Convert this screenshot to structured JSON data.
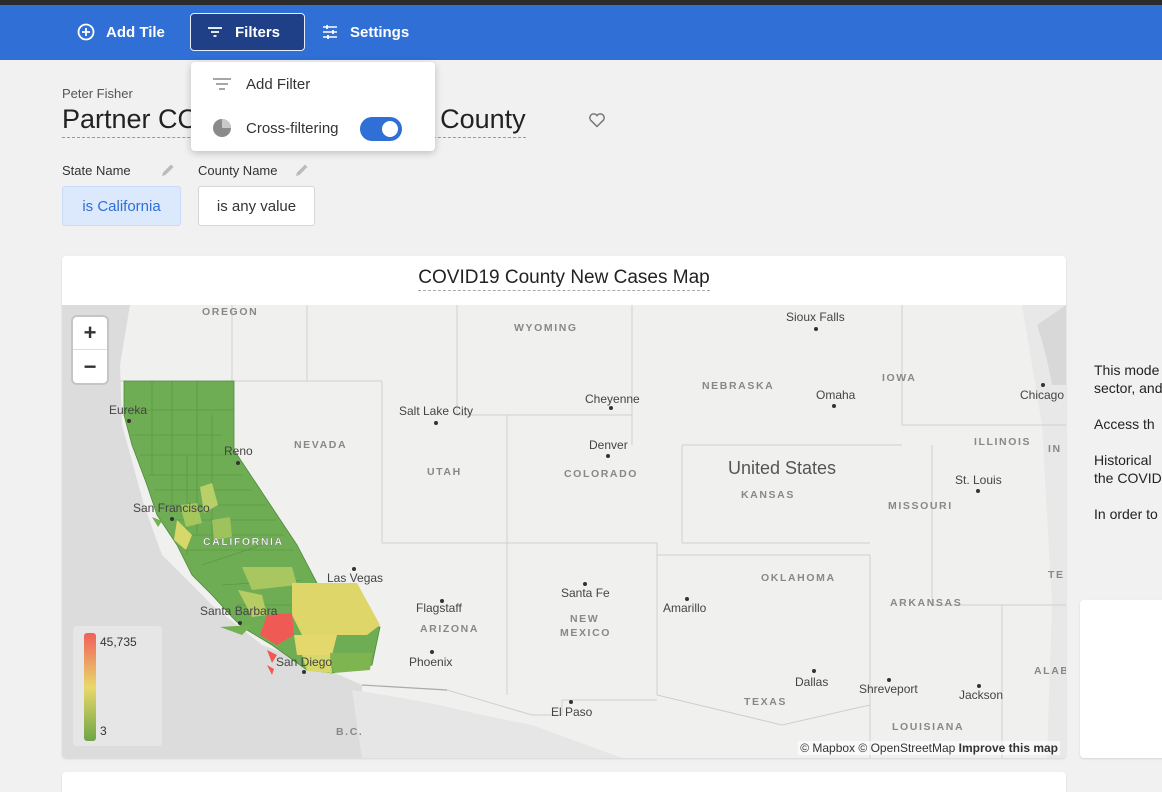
{
  "toolbar": {
    "add_tile": "Add Tile",
    "filters": "Filters",
    "settings": "Settings"
  },
  "filters_menu": {
    "add_filter": "Add Filter",
    "cross_filtering": "Cross-filtering",
    "cross_filtering_enabled": true
  },
  "dashboard": {
    "owner": "Peter Fisher",
    "title_visible_left": "Partner CO",
    "title_visible_right": "st by County"
  },
  "filters": [
    {
      "label": "State Name",
      "value": "is California",
      "active": true
    },
    {
      "label": "County Name",
      "value": "is any value",
      "active": false
    }
  ],
  "tile": {
    "title": "COVID19 County New Cases Map",
    "legend_max": "45,735",
    "legend_min": "3",
    "attribution_mapbox": "© Mapbox",
    "attribution_osm": "© OpenStreetMap",
    "attribution_improve": "Improve this map"
  },
  "map_labels": {
    "country": "United States",
    "states": [
      "OREGON",
      "WYOMING",
      "NEBRASKA",
      "IOWA",
      "NEVADA",
      "UTAH",
      "COLORADO",
      "KANSAS",
      "MISSOURI",
      "ILLINOIS",
      "CALIFORNIA",
      "OKLAHOMA",
      "ARKANSAS",
      "ARIZONA",
      "NEW",
      "MEXICO",
      "TEXAS",
      "LOUISIANA",
      "IN",
      "TE",
      "ALAB",
      "B.C."
    ],
    "cities": [
      "Sioux Falls",
      "Eureka",
      "Salt Lake City",
      "Cheyenne",
      "Omaha",
      "Chicago",
      "Denver",
      "Reno",
      "San Francisco",
      "St. Louis",
      "Las Vegas",
      "Santa Barbara",
      "Flagstaff",
      "Santa Fe",
      "Amarillo",
      "San Diego",
      "Phoenix",
      "Dallas",
      "Shreveport",
      "Jackson",
      "El Paso"
    ]
  },
  "side_text": {
    "line1a": "This mode",
    "line1b": "sector, and",
    "line2": "Access th",
    "line3a": "Historical",
    "line3b": "the COVID",
    "line4": "In order to"
  },
  "zoom": {
    "in": "+",
    "out": "−"
  }
}
